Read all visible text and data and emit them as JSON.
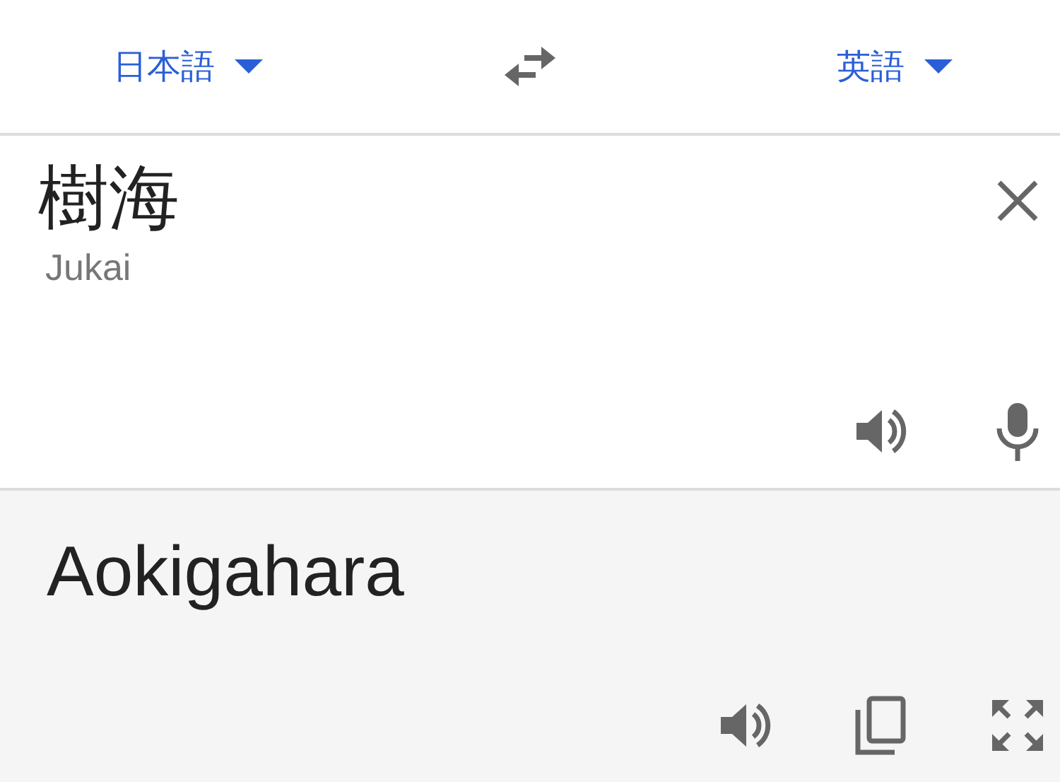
{
  "language_bar": {
    "source_language": "日本語",
    "target_language": "英語"
  },
  "input": {
    "text": "樹海",
    "transliteration": "Jukai"
  },
  "output": {
    "text": "Aokigahara"
  }
}
